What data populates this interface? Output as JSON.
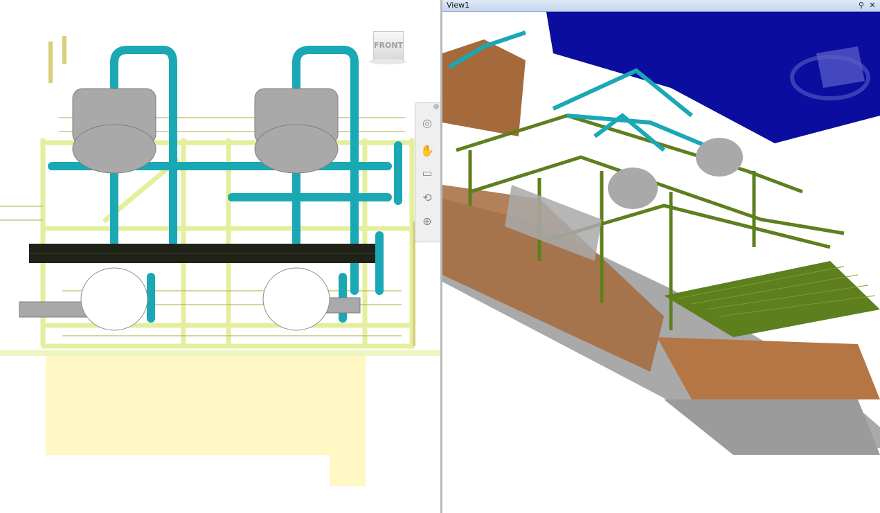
{
  "right_viewport": {
    "title": "View1",
    "pin_glyph": "pin-icon",
    "close_glyph": "✕"
  },
  "left_viewport": {
    "viewcube_label": "FRONT",
    "nav_bar_icons": [
      "steering-wheel-icon",
      "pan-hand-icon",
      "zoom-icon",
      "orbit-icon",
      "look-icon",
      "walk-icon"
    ]
  },
  "colors": {
    "structure_yellow": "#f0f5a8",
    "pipe_cyan": "#1aa8b5",
    "vessel_gray": "#a9a9a9",
    "steel_green": "#5d7f1d",
    "ground_brown": "#a56a3c",
    "building_blue": "#0b0d9e"
  }
}
